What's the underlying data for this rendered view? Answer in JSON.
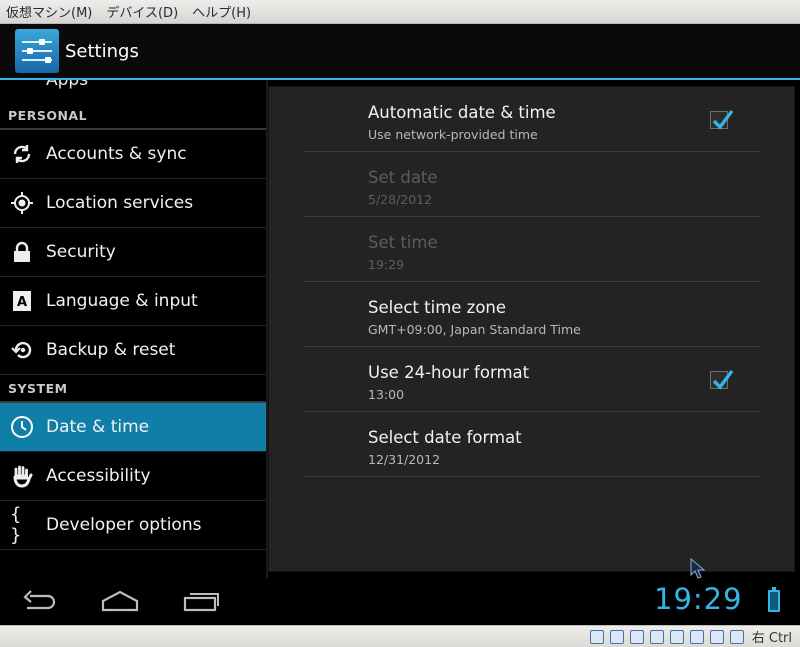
{
  "vm": {
    "menus": [
      "仮想マシン(M)",
      "デバイス(D)",
      "ヘルプ(H)"
    ],
    "host_key": "右 Ctrl"
  },
  "action_bar": {
    "title": "Settings",
    "icon": "settings-sliders-icon"
  },
  "left_list": {
    "partial_item": "Apps",
    "sections": [
      {
        "header": "PERSONAL",
        "items": [
          {
            "label": "Accounts & sync",
            "icon": "sync-icon"
          },
          {
            "label": "Location services",
            "icon": "location-icon"
          },
          {
            "label": "Security",
            "icon": "lock-icon"
          },
          {
            "label": "Language & input",
            "icon": "keyboard-a-icon"
          },
          {
            "label": "Backup & reset",
            "icon": "backup-icon"
          }
        ]
      },
      {
        "header": "SYSTEM",
        "items": [
          {
            "label": "Date & time",
            "icon": "clock-icon",
            "selected": true
          },
          {
            "label": "Accessibility",
            "icon": "hand-icon"
          },
          {
            "label": "Developer options",
            "icon": "braces-icon"
          }
        ]
      }
    ]
  },
  "detail": {
    "prefs": [
      {
        "title": "Automatic date & time",
        "summary": "Use network-provided time",
        "checkbox": true,
        "checked": true,
        "enabled": true
      },
      {
        "title": "Set date",
        "summary": "5/28/2012",
        "checkbox": false,
        "enabled": false
      },
      {
        "title": "Set time",
        "summary": "19:29",
        "checkbox": false,
        "enabled": false
      },
      {
        "title": "Select time zone",
        "summary": "GMT+09:00, Japan Standard Time",
        "checkbox": false,
        "enabled": true
      },
      {
        "title": "Use 24-hour format",
        "summary": "13:00",
        "checkbox": true,
        "checked": true,
        "enabled": true
      },
      {
        "title": "Select date format",
        "summary": "12/31/2012",
        "checkbox": false,
        "enabled": true
      }
    ]
  },
  "status": {
    "clock": "19:29",
    "battery": "charging",
    "accent": "#33b5e5"
  }
}
